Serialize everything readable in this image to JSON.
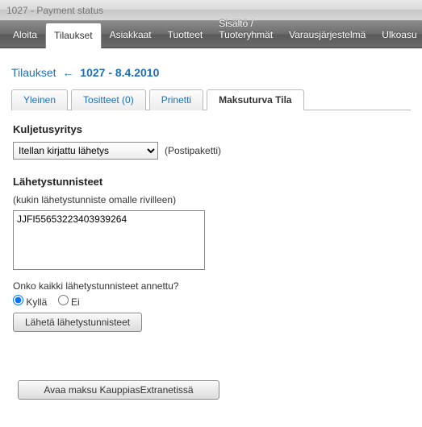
{
  "window": {
    "title": "1027 - Payment status"
  },
  "menu": {
    "items": [
      {
        "label": "Aloita"
      },
      {
        "label": "Tilaukset",
        "active": true
      },
      {
        "label": "Asiakkaat"
      },
      {
        "label": "Tuotteet"
      },
      {
        "label": "Sisältö / Tuoteryhmät"
      },
      {
        "label": "Varausjärjestelmä"
      },
      {
        "label": "Ulkoasu"
      }
    ]
  },
  "breadcrumb": {
    "root": "Tilaukset",
    "arrow": "←",
    "current": "1027 - 8.4.2010"
  },
  "tabs": {
    "items": [
      {
        "label": "Yleinen"
      },
      {
        "label": "Tositteet (0)"
      },
      {
        "label": "Prinetti"
      },
      {
        "label": "Maksuturva Tila",
        "active": true
      }
    ]
  },
  "carrier": {
    "heading": "Kuljetusyritys",
    "selected": "Itellan kirjattu lähetys",
    "paren": "(Postipaketti)"
  },
  "tracking": {
    "heading": "Lähetystunnisteet",
    "sub": "(kukin lähetystunniste omalle rivilleen)",
    "value": "JJFI55653223403939264",
    "question": "Onko kaikki lähetystunnisteet annettu?",
    "opt_yes": "Kyllä",
    "opt_no": "Ei",
    "selected": "yes",
    "submit": "Lähetä lähetystunnisteet"
  },
  "open_merchant": {
    "label": "Avaa maksu KauppiasExtranetissä"
  }
}
